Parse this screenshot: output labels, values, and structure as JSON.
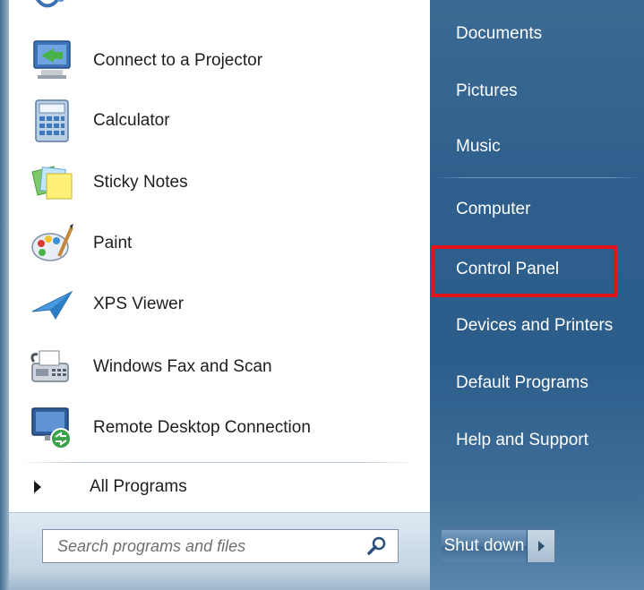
{
  "programs": [
    {
      "label": "Connect to a Projector",
      "icon": "projector-icon"
    },
    {
      "label": "Calculator",
      "icon": "calculator-icon"
    },
    {
      "label": "Sticky Notes",
      "icon": "sticky-notes-icon"
    },
    {
      "label": "Paint",
      "icon": "paint-icon"
    },
    {
      "label": "XPS Viewer",
      "icon": "xps-viewer-icon"
    },
    {
      "label": "Windows Fax and Scan",
      "icon": "fax-scan-icon"
    },
    {
      "label": "Remote Desktop Connection",
      "icon": "remote-desktop-icon"
    }
  ],
  "all_programs": {
    "label": "All Programs"
  },
  "search": {
    "placeholder": "Search programs and files",
    "value": ""
  },
  "right_links": [
    {
      "label": "Documents"
    },
    {
      "label": "Pictures"
    },
    {
      "label": "Music"
    },
    {
      "label": "Computer"
    },
    {
      "label": "Control Panel",
      "highlighted": true
    },
    {
      "label": "Devices and Printers"
    },
    {
      "label": "Default Programs"
    },
    {
      "label": "Help and Support"
    }
  ],
  "shutdown": {
    "label": "Shut down"
  },
  "colors": {
    "right_pane": "#2b5d8b",
    "highlight": "#e3131b",
    "text": "#1e1e1e"
  }
}
